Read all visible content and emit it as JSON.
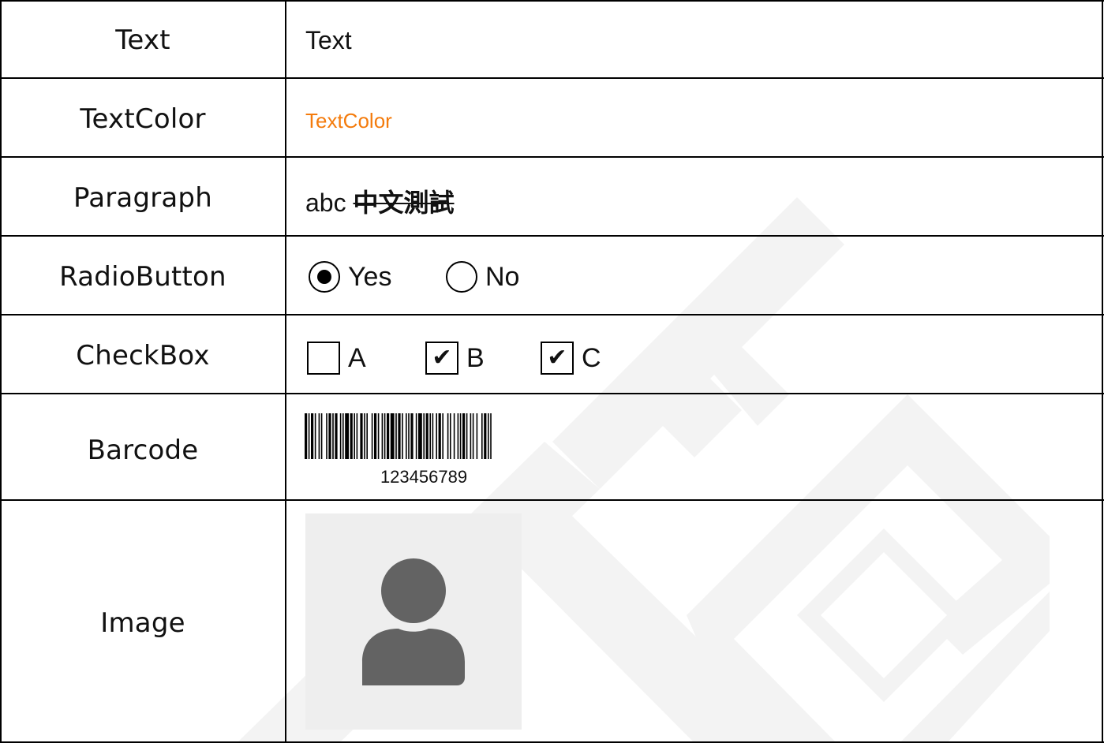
{
  "rows": {
    "text": {
      "label": "Text",
      "value": "Text"
    },
    "text_color": {
      "label": "TextColor",
      "value": "TextColor",
      "color": "#f47b0c"
    },
    "paragraph": {
      "label": "Paragraph",
      "plain": "abc ",
      "struck": "中文測試"
    },
    "radio": {
      "label": "RadioButton",
      "options": [
        {
          "label": "Yes",
          "selected": true
        },
        {
          "label": "No",
          "selected": false
        }
      ]
    },
    "checkbox": {
      "label": "CheckBox",
      "options": [
        {
          "label": "A",
          "checked": false
        },
        {
          "label": "B",
          "checked": true
        },
        {
          "label": "C",
          "checked": true
        }
      ],
      "check_glyph": "✔"
    },
    "barcode": {
      "label": "Barcode",
      "value": "123456789"
    },
    "image": {
      "label": "Image",
      "icon": "user-avatar-icon"
    }
  }
}
